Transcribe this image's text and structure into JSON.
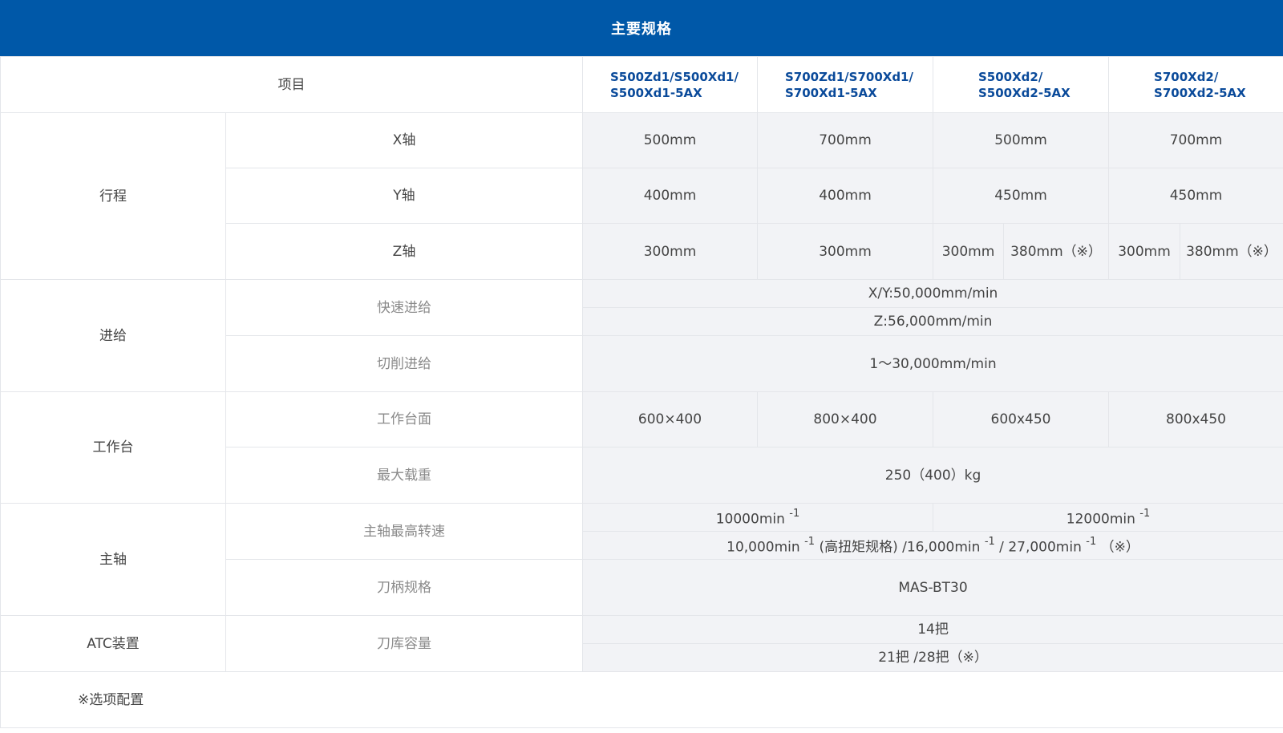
{
  "header": {
    "title": "主要规格"
  },
  "columns": {
    "item": "项目",
    "models": [
      [
        "S500Zd1/S500Xd1/",
        "S500Xd1-5AX"
      ],
      [
        "S700Zd1/S700Xd1/",
        "S700Xd1-5AX"
      ],
      [
        "S500Xd2/",
        "S500Xd2-5AX"
      ],
      [
        "S700Xd2/",
        "S700Xd2-5AX"
      ]
    ]
  },
  "sections": {
    "travel": {
      "label": "行程",
      "x_axis": {
        "label": "X轴",
        "values": [
          "500mm",
          "700mm",
          "500mm",
          "700mm"
        ]
      },
      "y_axis": {
        "label": "Y轴",
        "values": [
          "400mm",
          "400mm",
          "450mm",
          "450mm"
        ]
      },
      "z_axis": {
        "label": "Z轴",
        "values": [
          "300mm",
          "300mm",
          "300mm",
          "380mm（※）",
          "300mm",
          "380mm（※）"
        ]
      }
    },
    "feed": {
      "label": "进给",
      "rapid": {
        "label": "快速进给",
        "line1": "X/Y:50,000mm/min",
        "line2": "Z:56,000mm/min"
      },
      "cutting": {
        "label": "切削进给",
        "value": "1～30,000mm/min"
      }
    },
    "table": {
      "label": "工作台",
      "surface": {
        "label": "工作台面",
        "values": [
          "600×400",
          "800×400",
          "600x450",
          "800x450"
        ]
      },
      "max_load": {
        "label": "最大载重",
        "value": "250（400）kg"
      }
    },
    "spindle": {
      "label": "主轴",
      "max_speed": {
        "label": "主轴最高转速",
        "a_base": "10000min ",
        "a_sup": "-1",
        "b_base": "12000min ",
        "b_sup": "-1",
        "l2_p1": "10,000min ",
        "l2_s1": "-1",
        "l2_p2": " (高扭矩规格) /16,000min ",
        "l2_s2": "-1",
        "l2_p3": "  / 27,000min ",
        "l2_s3": "-1",
        "l2_p4": " （※）"
      },
      "holder": {
        "label": "刀柄规格",
        "value": "MAS-BT30"
      }
    },
    "atc": {
      "label": "ATC装置",
      "capacity": {
        "label": "刀库容量",
        "line1": "14把",
        "line2": "21把 /28把（※）"
      }
    }
  },
  "footnote": "※选项配置"
}
